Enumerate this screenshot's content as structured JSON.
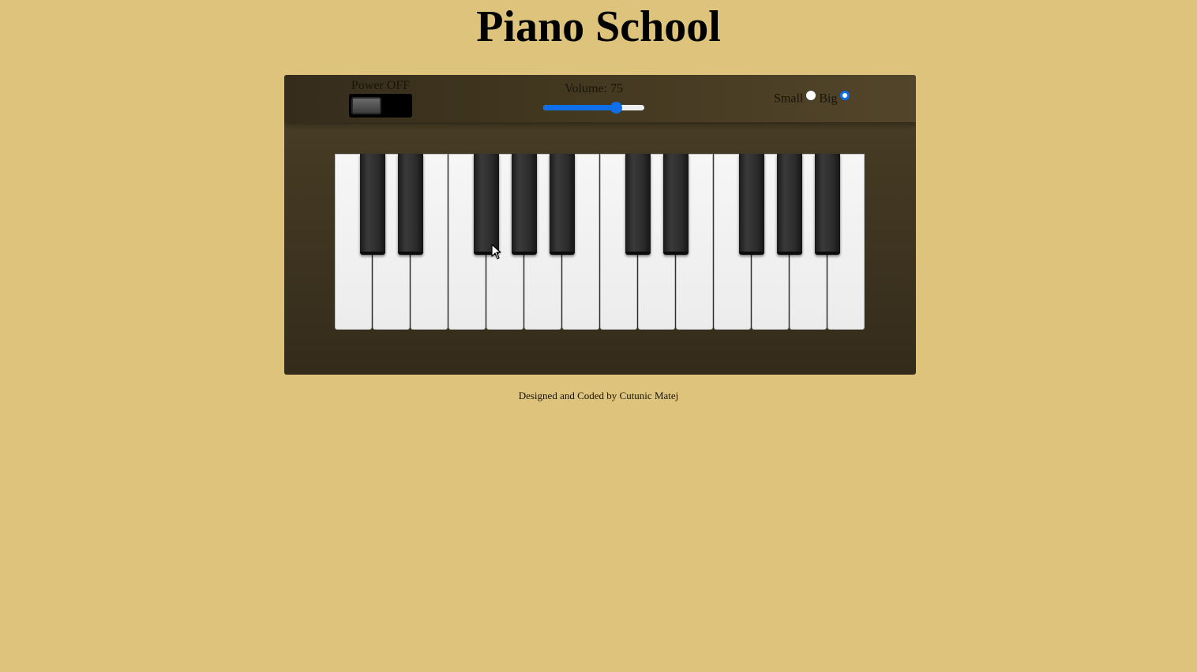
{
  "page": {
    "title": "Piano School",
    "footer": "Designed and Coded by Cutunic Matej"
  },
  "controls": {
    "power": {
      "label": "Power OFF",
      "state": "off"
    },
    "volume": {
      "label_prefix": "Volume: ",
      "value": "75",
      "min": 0,
      "max": 100
    },
    "size": {
      "options": [
        {
          "label": "Small",
          "checked": false
        },
        {
          "label": "Big",
          "checked": true
        }
      ]
    }
  },
  "keyboard": {
    "white_keys": 14,
    "black_key_after_white": [
      0,
      1,
      3,
      4,
      5,
      7,
      8,
      10,
      11,
      12
    ]
  },
  "colors": {
    "page_background": "#ddc37b",
    "piano_body": "#3e3420",
    "accent": "#0f6fe8"
  }
}
